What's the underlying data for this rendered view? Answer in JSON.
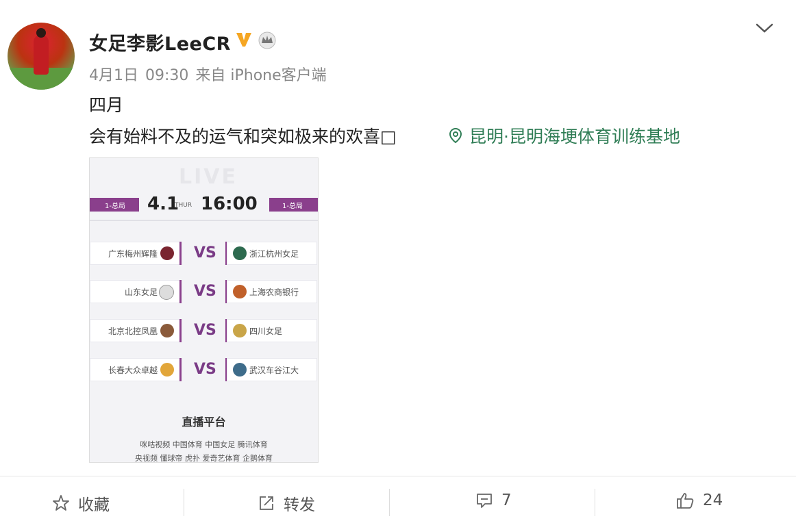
{
  "post": {
    "username": "女足李影LeeCR",
    "meta": {
      "date": "4月1日",
      "time": "09:30",
      "source": "来自 iPhone客户端"
    },
    "text_line1": "四月",
    "text_line2": "会有始料不及的运气和突如极来的欢喜□",
    "location": "昆明·昆明海埂体育训练基地",
    "colors": {
      "accent_location": "#2f7d55",
      "verified": "#f5a623",
      "poster_purple": "#8a3f8c"
    }
  },
  "poster": {
    "watermark": "LIVE",
    "date": "4.1",
    "weekday": "THUR",
    "time": "16:00",
    "tag_left": "1-总局",
    "tag_right": "1-总局",
    "vs_label": "VS",
    "matches": [
      {
        "home": "广东梅州辉隆",
        "away": "浙江杭州女足"
      },
      {
        "home": "山东女足",
        "away": "上海农商银行"
      },
      {
        "home": "北京北控凤凰",
        "away": "四川女足"
      },
      {
        "home": "长春大众卓越",
        "away": "武汉车谷江大"
      }
    ],
    "platform_title": "直播平台",
    "platform_row1": "咪咕视频  中国体育  中国女足  腾讯体育",
    "platform_row2": "央视频  懂球帝  虎扑  爱奇艺体育  企鹅体育"
  },
  "actions": {
    "favorite": "收藏",
    "repost": "转发",
    "comments": "7",
    "likes": "24"
  }
}
